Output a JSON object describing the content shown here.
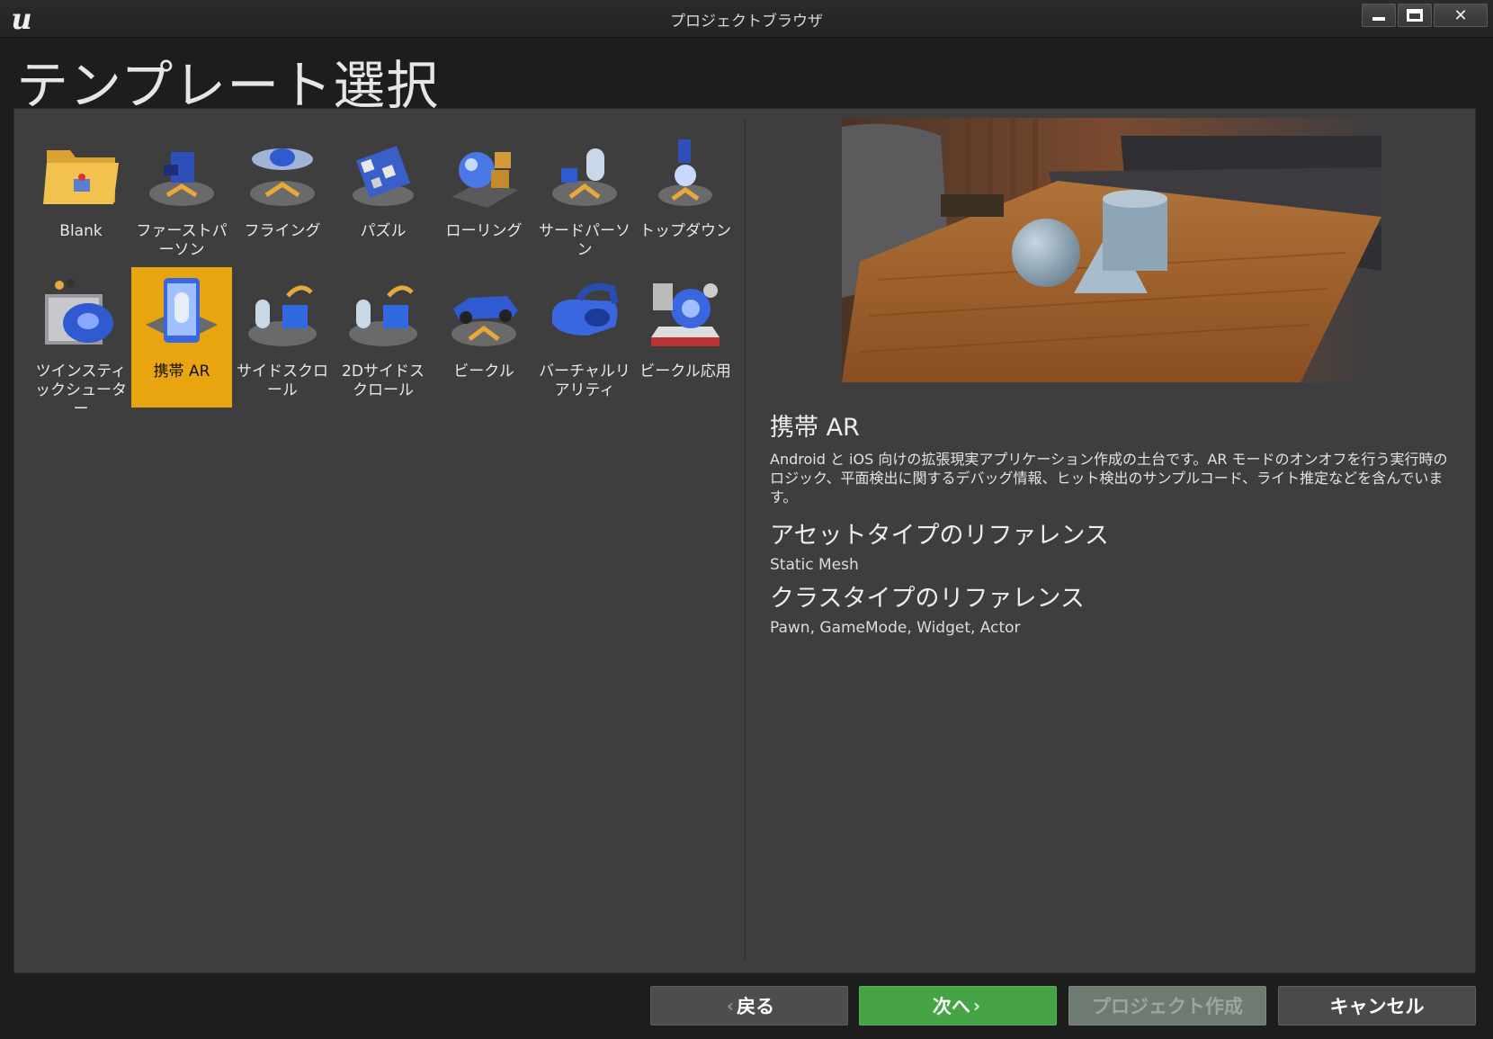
{
  "window": {
    "title": "プロジェクトブラウザ",
    "controls": [
      "minimize",
      "maximize",
      "close"
    ],
    "close_glyph": "✕"
  },
  "page_title": "テンプレート選択",
  "templates": [
    {
      "label": "Blank",
      "icon": "folder-icon"
    },
    {
      "label": "ファーストパーソン",
      "icon": "first-person-icon"
    },
    {
      "label": "フライング",
      "icon": "flying-icon"
    },
    {
      "label": "パズル",
      "icon": "puzzle-icon"
    },
    {
      "label": "ローリング",
      "icon": "rolling-icon"
    },
    {
      "label": "サードパーソン",
      "icon": "third-person-icon"
    },
    {
      "label": "トップダウン",
      "icon": "top-down-icon"
    },
    {
      "label": "ツインスティックシューター",
      "icon": "twin-stick-icon"
    },
    {
      "label": "携帯 AR",
      "icon": "handheld-ar-icon",
      "selected": true
    },
    {
      "label": "サイドスクロール",
      "icon": "side-scroller-icon"
    },
    {
      "label": "2Dサイドスクロール",
      "icon": "2d-side-scroller-icon"
    },
    {
      "label": "ビークル",
      "icon": "vehicle-icon"
    },
    {
      "label": "バーチャルリアリティ",
      "icon": "vr-headset-icon"
    },
    {
      "label": "ビークル応用",
      "icon": "advanced-vehicle-icon"
    }
  ],
  "detail": {
    "title": "携帯 AR",
    "description": "Android と iOS 向けの拡張現実アプリケーション作成の土台です。AR モードのオンオフを行う実行時のロジック、平面検出に関するデバッグ情報、ヒット検出のサンプルコード、ライト推定などを含んでいます。",
    "asset_ref_heading": "アセットタイプのリファレンス",
    "asset_ref_value": "Static Mesh",
    "class_ref_heading": "クラスタイプのリファレンス",
    "class_ref_value": "Pawn, GameMode, Widget, Actor"
  },
  "buttons": {
    "back": "戻る",
    "next": "次へ",
    "create": "プロジェクト作成",
    "cancel": "キャンセル"
  },
  "colors": {
    "selected_tile": "#e8a50f",
    "next_button": "#45a346",
    "panel_bg": "#3e3e3e"
  }
}
